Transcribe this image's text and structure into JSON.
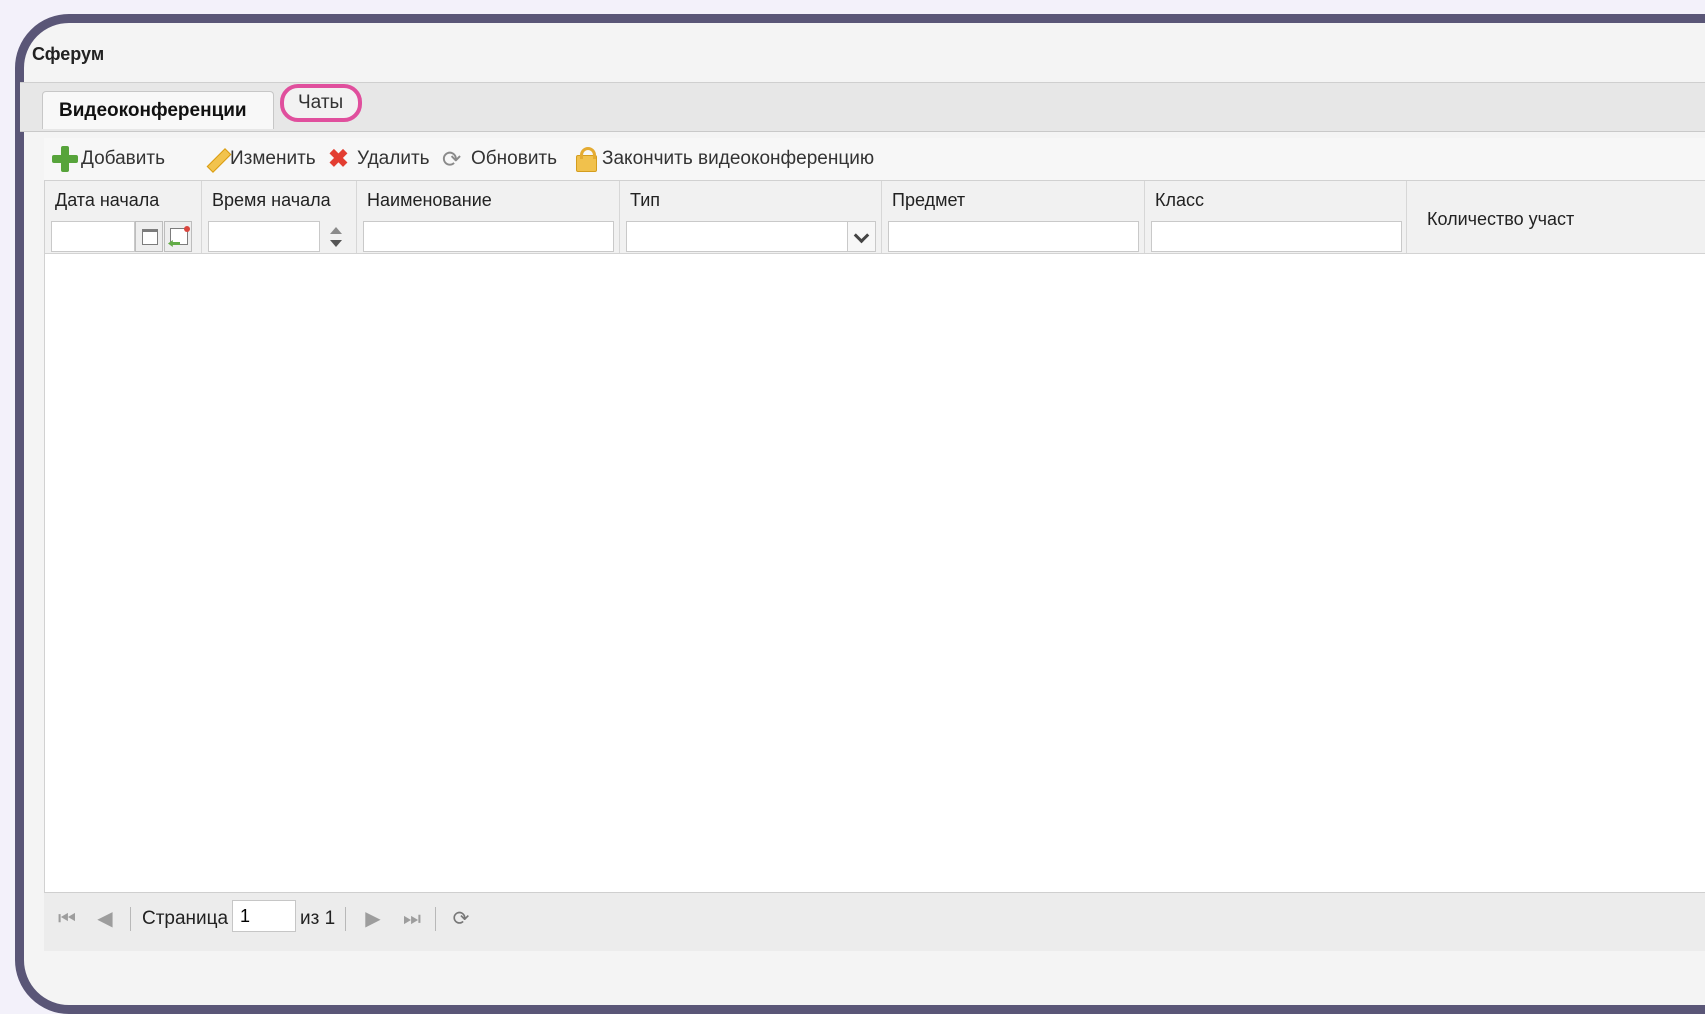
{
  "window": {
    "title": "Сферум"
  },
  "tabs": [
    {
      "label": "Видеоконференции"
    },
    {
      "label": "Чаты"
    }
  ],
  "toolbar": {
    "add": "Добавить",
    "edit": "Изменить",
    "delete": "Удалить",
    "refresh": "Обновить",
    "finish": "Закончить видеоконференцию"
  },
  "grid": {
    "columns": [
      {
        "label": "Дата начала",
        "filter_value": ""
      },
      {
        "label": "Время начала",
        "filter_value": ""
      },
      {
        "label": "Наименование",
        "filter_value": ""
      },
      {
        "label": "Тип",
        "filter_value": ""
      },
      {
        "label": "Предмет",
        "filter_value": ""
      },
      {
        "label": "Класс",
        "filter_value": ""
      },
      {
        "label": "Количество участ"
      }
    ],
    "rows": []
  },
  "pager": {
    "page_label": "Страница",
    "page_value": "1",
    "of_label": "из 1"
  }
}
